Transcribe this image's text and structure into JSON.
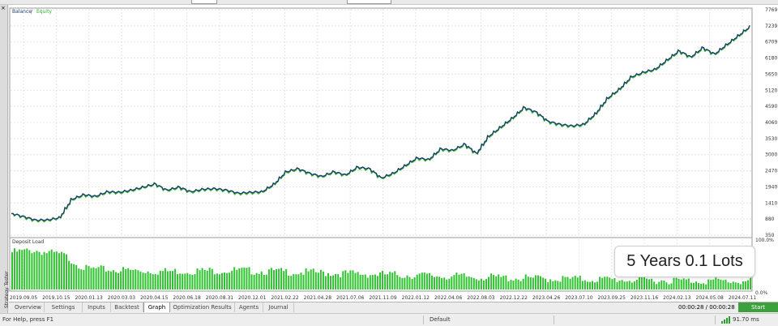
{
  "chart": {
    "title": "Balance / Equity",
    "title_part1": "Balance",
    "title_sep": " / ",
    "title_part2": "Equity",
    "balance_color": "#1f3b73",
    "equity_color": "#2fb52f",
    "y_ticks": [
      "7769",
      "7239",
      "6709",
      "6180",
      "5650",
      "5120",
      "4590",
      "4060",
      "3530",
      "3000",
      "2470",
      "1940",
      "1410",
      "880",
      "350"
    ],
    "x_ticks": [
      "2019.09.05",
      "2019.10.15",
      "2020.01.13",
      "2020.03.03",
      "2020.04.15",
      "2020.06.18",
      "2020.08.31",
      "2020.12.01",
      "2021.02.22",
      "2021.04.28",
      "2021.07.06",
      "2021.11.09",
      "2022.01.12",
      "2022.04.06",
      "2022.08.03",
      "2022.12.22",
      "2023.04.26",
      "2023.07.10",
      "2023.09.25",
      "2023.11.16",
      "2024.02.13",
      "2024.05.08",
      "2024.07.11"
    ]
  },
  "deposit_load": {
    "title": "Deposit Load",
    "y_max_label": "100.0%",
    "y_min_label": "0.0%",
    "bar_color": "#2ec22e"
  },
  "chart_data": [
    {
      "type": "line",
      "title": "Balance / Equity",
      "series": [
        {
          "name": "Balance",
          "values": [
            1080,
            980,
            870,
            880,
            950,
            1550,
            1700,
            1650,
            1800,
            1780,
            1850,
            1950,
            2050,
            1850,
            1950,
            1800,
            1880,
            1900,
            1850,
            1750,
            1780,
            1800,
            2050,
            2450,
            2550,
            2400,
            2300,
            2450,
            2350,
            2600,
            2550,
            2250,
            2400,
            2650,
            2900,
            2850,
            3200,
            3150,
            3350,
            3050,
            3600,
            3900,
            4200,
            4550,
            4400,
            4100,
            4000,
            3950,
            4000,
            4350,
            4850,
            5150,
            5550,
            5700,
            5800,
            6100,
            6400,
            6200,
            6500,
            6300,
            6600,
            6900,
            7200
          ]
        },
        {
          "name": "Equity",
          "values": [
            1080,
            960,
            850,
            860,
            940,
            1530,
            1680,
            1630,
            1780,
            1760,
            1830,
            1930,
            2040,
            1830,
            1930,
            1780,
            1860,
            1880,
            1830,
            1730,
            1760,
            1780,
            2030,
            2430,
            2530,
            2380,
            2280,
            2430,
            2330,
            2580,
            2530,
            2230,
            2380,
            2630,
            2880,
            2830,
            3180,
            3130,
            3330,
            3030,
            3580,
            3880,
            4180,
            4530,
            4380,
            4080,
            3980,
            3930,
            3980,
            4330,
            4830,
            5130,
            5530,
            5680,
            5780,
            6080,
            6380,
            6180,
            6480,
            6280,
            6580,
            6880,
            7190
          ]
        }
      ],
      "x": [
        "2019.09.05",
        "2019.10.15",
        "2020.01.13",
        "2020.03.03",
        "2020.04.15",
        "2020.06.18",
        "2020.08.31",
        "2020.12.01",
        "2021.02.22",
        "2021.04.28",
        "2021.07.06",
        "2021.11.09",
        "2022.01.12",
        "2022.04.06",
        "2022.08.03",
        "2022.12.22",
        "2023.04.26",
        "2023.07.10",
        "2023.09.25",
        "2023.11.16",
        "2024.02.13",
        "2024.05.08",
        "2024.07.11"
      ],
      "ylim": [
        350,
        7769
      ],
      "grid": true
    },
    {
      "type": "bar",
      "title": "Deposit Load",
      "ylim": [
        0,
        100
      ],
      "profile": [
        [
          0,
          0.78
        ],
        [
          0.03,
          0.82
        ],
        [
          0.07,
          0.72
        ],
        [
          0.1,
          0.45
        ],
        [
          0.2,
          0.4
        ],
        [
          0.3,
          0.42
        ],
        [
          0.4,
          0.38
        ],
        [
          0.5,
          0.34
        ],
        [
          0.6,
          0.3
        ],
        [
          0.7,
          0.26
        ],
        [
          0.8,
          0.24
        ],
        [
          0.9,
          0.22
        ],
        [
          1,
          0.2
        ]
      ]
    }
  ],
  "tabs": [
    "Overview",
    "Settings",
    "Inputs",
    "Backtest",
    "Graph",
    "Optimization Results",
    "Agents",
    "Journal"
  ],
  "active_tab": "Graph",
  "timer": "00:00:28 / 00:00:28",
  "start_button": "Start",
  "side_tab": {
    "close": "×",
    "label": "Strategy Tester"
  },
  "overlay_text": "5 Years 0.1 Lots",
  "status": {
    "help": "For Help, press F1",
    "profile": "Default",
    "ping": "91.70 ms"
  }
}
